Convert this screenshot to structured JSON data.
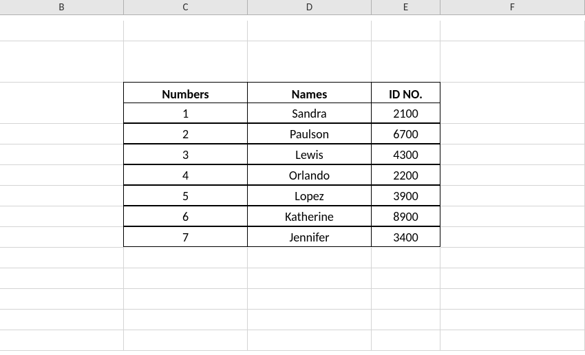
{
  "columns": [
    "B",
    "C",
    "D",
    "E",
    "F"
  ],
  "table": {
    "headers": [
      "Numbers",
      "Names",
      "ID NO."
    ],
    "rows": [
      {
        "number": "1",
        "name": "Sandra",
        "id": "2100"
      },
      {
        "number": "2",
        "name": "Paulson",
        "id": "6700"
      },
      {
        "number": "3",
        "name": "Lewis",
        "id": "4300"
      },
      {
        "number": "4",
        "name": "Orlando",
        "id": "2200"
      },
      {
        "number": "5",
        "name": "Lopez",
        "id": "3900"
      },
      {
        "number": "6",
        "name": "Katherine",
        "id": "8900"
      },
      {
        "number": "7",
        "name": "Jennifer",
        "id": "3400"
      }
    ]
  }
}
